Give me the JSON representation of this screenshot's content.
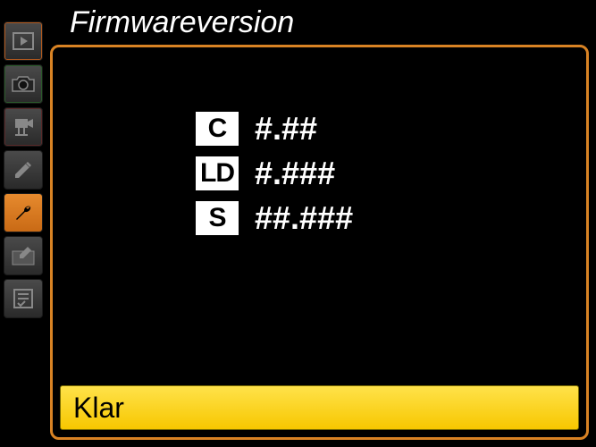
{
  "header": {
    "title": "Firmwareversion"
  },
  "sidebar": {
    "items": [
      {
        "name": "playback",
        "icon": "play"
      },
      {
        "name": "photo-shooting",
        "icon": "camera"
      },
      {
        "name": "movie-shooting",
        "icon": "video"
      },
      {
        "name": "custom-settings",
        "icon": "pencil"
      },
      {
        "name": "setup",
        "icon": "wrench",
        "active": true
      },
      {
        "name": "retouch",
        "icon": "retouch"
      },
      {
        "name": "my-menu",
        "icon": "list"
      }
    ]
  },
  "firmware": {
    "rows": [
      {
        "badge": "C",
        "value": "#.##"
      },
      {
        "badge": "LD",
        "value": "#.###"
      },
      {
        "badge": "S",
        "value": "##.###"
      }
    ]
  },
  "action": {
    "label": "Klar"
  }
}
